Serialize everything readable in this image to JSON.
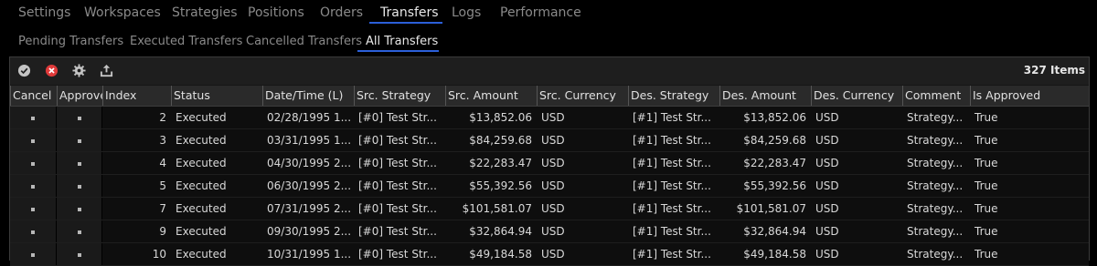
{
  "top_tabs": [
    "Settings",
    "Workspaces",
    "Strategies",
    "Positions",
    "Orders",
    "Transfers",
    "Logs",
    "Performance"
  ],
  "active_top_tab": "Transfers",
  "sub_tabs": [
    "Pending Transfers",
    "Executed Transfers",
    "Cancelled Transfers",
    "All Transfers"
  ],
  "active_sub_tab": "All Transfers",
  "toolbar": {
    "item_count": "327 Items",
    "icons": [
      "check-circle-icon",
      "cancel-circle-icon",
      "gear-icon",
      "export-icon"
    ]
  },
  "colors": {
    "accent": "#2b5fd9",
    "cancel_red": "#e03a3a"
  },
  "columns": [
    "Cancel",
    "Approve",
    "Index",
    "Status",
    "Date/Time (L)",
    "Src. Strategy",
    "Src. Amount",
    "Src. Currency",
    "Des. Strategy",
    "Des. Amount",
    "Des. Currency",
    "Comment",
    "Is Approved"
  ],
  "rows": [
    {
      "index": "2",
      "status": "Executed",
      "datetime": "02/28/1995 1...",
      "src_strategy": "[#0] Test Str...",
      "src_amount": "$13,852.06",
      "src_currency": "USD",
      "des_strategy": "[#1] Test Str...",
      "des_amount": "$13,852.06",
      "des_currency": "USD",
      "comment": "Strategy...",
      "is_approved": "True"
    },
    {
      "index": "3",
      "status": "Executed",
      "datetime": "03/31/1995 1...",
      "src_strategy": "[#0] Test Str...",
      "src_amount": "$84,259.68",
      "src_currency": "USD",
      "des_strategy": "[#1] Test Str...",
      "des_amount": "$84,259.68",
      "des_currency": "USD",
      "comment": "Strategy...",
      "is_approved": "True"
    },
    {
      "index": "4",
      "status": "Executed",
      "datetime": "04/30/1995 2...",
      "src_strategy": "[#0] Test Str...",
      "src_amount": "$22,283.47",
      "src_currency": "USD",
      "des_strategy": "[#1] Test Str...",
      "des_amount": "$22,283.47",
      "des_currency": "USD",
      "comment": "Strategy...",
      "is_approved": "True"
    },
    {
      "index": "5",
      "status": "Executed",
      "datetime": "06/30/1995 2...",
      "src_strategy": "[#0] Test Str...",
      "src_amount": "$55,392.56",
      "src_currency": "USD",
      "des_strategy": "[#1] Test Str...",
      "des_amount": "$55,392.56",
      "des_currency": "USD",
      "comment": "Strategy...",
      "is_approved": "True"
    },
    {
      "index": "7",
      "status": "Executed",
      "datetime": "07/31/1995 2...",
      "src_strategy": "[#0] Test Str...",
      "src_amount": "$101,581.07",
      "src_currency": "USD",
      "des_strategy": "[#1] Test Str...",
      "des_amount": "$101,581.07",
      "des_currency": "USD",
      "comment": "Strategy...",
      "is_approved": "True"
    },
    {
      "index": "9",
      "status": "Executed",
      "datetime": "09/30/1995 2...",
      "src_strategy": "[#0] Test Str...",
      "src_amount": "$32,864.94",
      "src_currency": "USD",
      "des_strategy": "[#1] Test Str...",
      "des_amount": "$32,864.94",
      "des_currency": "USD",
      "comment": "Strategy...",
      "is_approved": "True"
    },
    {
      "index": "10",
      "status": "Executed",
      "datetime": "10/31/1995 1...",
      "src_strategy": "[#0] Test Str...",
      "src_amount": "$49,184.58",
      "src_currency": "USD",
      "des_strategy": "[#1] Test Str...",
      "des_amount": "$49,184.58",
      "des_currency": "USD",
      "comment": "Strategy...",
      "is_approved": "True"
    }
  ]
}
